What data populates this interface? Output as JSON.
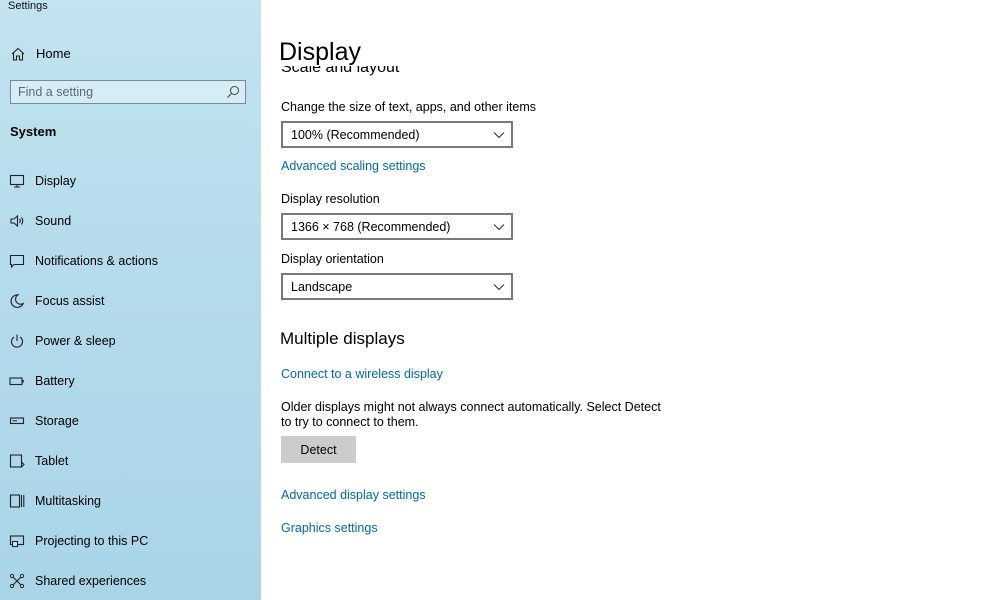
{
  "app": {
    "title": "Settings"
  },
  "sidebar": {
    "home_label": "Home",
    "search_placeholder": "Find a setting",
    "section_title": "System",
    "items": [
      {
        "label": "Display",
        "icon": "monitor-icon"
      },
      {
        "label": "Sound",
        "icon": "speaker-icon"
      },
      {
        "label": "Notifications & actions",
        "icon": "notification-icon"
      },
      {
        "label": "Focus assist",
        "icon": "moon-icon"
      },
      {
        "label": "Power & sleep",
        "icon": "power-icon"
      },
      {
        "label": "Battery",
        "icon": "battery-icon"
      },
      {
        "label": "Storage",
        "icon": "storage-icon"
      },
      {
        "label": "Tablet",
        "icon": "tablet-icon"
      },
      {
        "label": "Multitasking",
        "icon": "multitasking-icon"
      },
      {
        "label": "Projecting to this PC",
        "icon": "projecting-icon"
      },
      {
        "label": "Shared experiences",
        "icon": "shared-experiences-icon"
      }
    ]
  },
  "main": {
    "page_title": "Display",
    "section_scale": "Scale and layout",
    "scale_label": "Change the size of text, apps, and other items",
    "scale_value": "100% (Recommended)",
    "advanced_scaling_link": "Advanced scaling settings",
    "resolution_label": "Display resolution",
    "resolution_value": "1366 × 768 (Recommended)",
    "orientation_label": "Display orientation",
    "orientation_value": "Landscape",
    "multiple_displays_title": "Multiple displays",
    "wireless_link": "Connect to a wireless display",
    "detect_description": "Older displays might not always connect automatically. Select Detect to try to connect to them.",
    "detect_button": "Detect",
    "advanced_display_link": "Advanced display settings",
    "graphics_link": "Graphics settings"
  },
  "colors": {
    "link": "#0067b8",
    "sidebar_bg": "#b6dcec",
    "button_bg": "#cccccc"
  }
}
